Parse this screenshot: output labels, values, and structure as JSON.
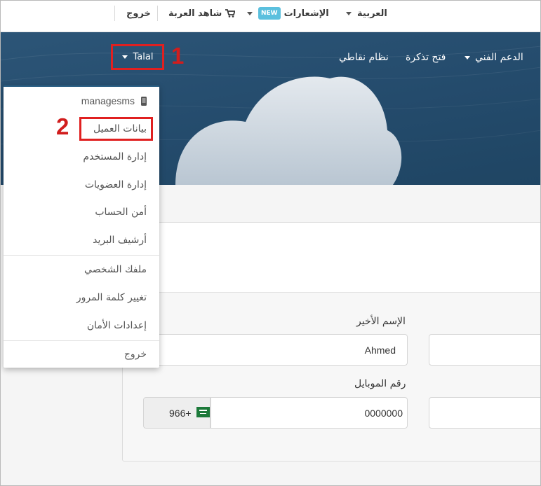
{
  "topbar": {
    "language": "العربية",
    "notifications": "الإشعارات",
    "new_badge": "NEW",
    "cart": "شاهد العربة",
    "logout": "خروج"
  },
  "hero_nav": {
    "support": "الدعم الفني",
    "open_ticket": "فتح تذكرة",
    "points": "نظام نقاطي",
    "user": "Talal"
  },
  "annotations": {
    "step1": "1",
    "step2": "2",
    "highlight_color": "#e02020"
  },
  "dropdown": {
    "items": [
      {
        "label": "managesms",
        "icon": "mobile-phone-icon"
      },
      {
        "label": "بيانات العميل"
      },
      {
        "label": "إدارة المستخدم"
      },
      {
        "label": "إدارة العضويات"
      },
      {
        "label": "أمن الحساب"
      },
      {
        "label": "أرشيف البريد"
      },
      {
        "label": "ملفك الشخصي"
      },
      {
        "label": "تغيير كلمة المرور"
      },
      {
        "label": "إعدادات الأمان"
      },
      {
        "label": "خروج"
      }
    ]
  },
  "form": {
    "last_name_label": "الإسم الأخير",
    "last_name_value": "Ahmed",
    "mobile_label": "رقم الموبايل",
    "mobile_value": "0000000",
    "country_code": "966+"
  },
  "colors": {
    "hero": "#244b6c",
    "badge": "#5bc0de"
  }
}
